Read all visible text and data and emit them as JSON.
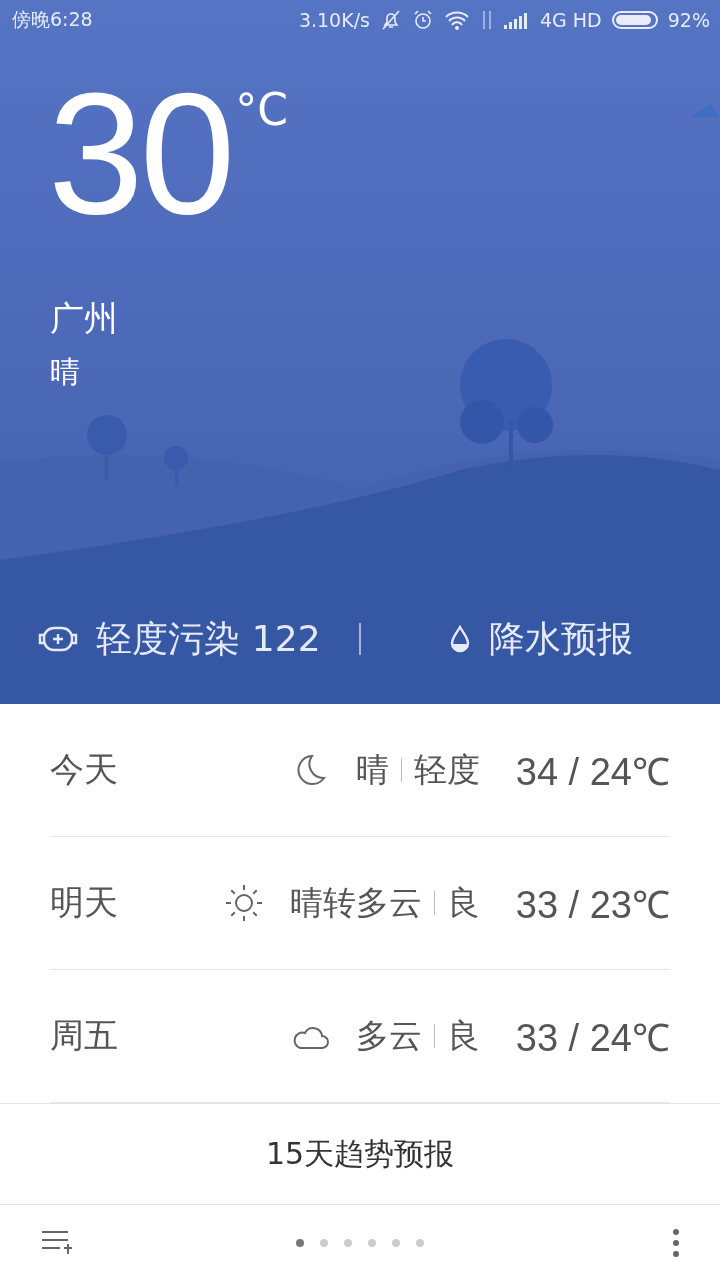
{
  "status_bar": {
    "time": "傍晚6:28",
    "speed": "3.10K/s",
    "network": "4G HD",
    "battery": "92%"
  },
  "current": {
    "temperature": "30",
    "unit": "°C",
    "city": "广州",
    "condition": "晴"
  },
  "air": {
    "label": "轻度污染 122"
  },
  "rain": {
    "label": "降水预报"
  },
  "forecast": [
    {
      "day": "今天",
      "kind": "moon",
      "condition": "晴",
      "air": "轻度",
      "temps": "34 / 24℃"
    },
    {
      "day": "明天",
      "kind": "sun",
      "condition": "晴转多云",
      "air": "良",
      "temps": "33 / 23℃"
    },
    {
      "day": "周五",
      "kind": "cloud",
      "condition": "多云",
      "air": "良",
      "temps": "33 / 24℃"
    }
  ],
  "trend_link": "15天趋势预报",
  "pages": [
    {
      "selected": true
    },
    {
      "selected": false
    },
    {
      "selected": false
    },
    {
      "selected": false
    },
    {
      "selected": false
    },
    {
      "selected": false
    }
  ]
}
